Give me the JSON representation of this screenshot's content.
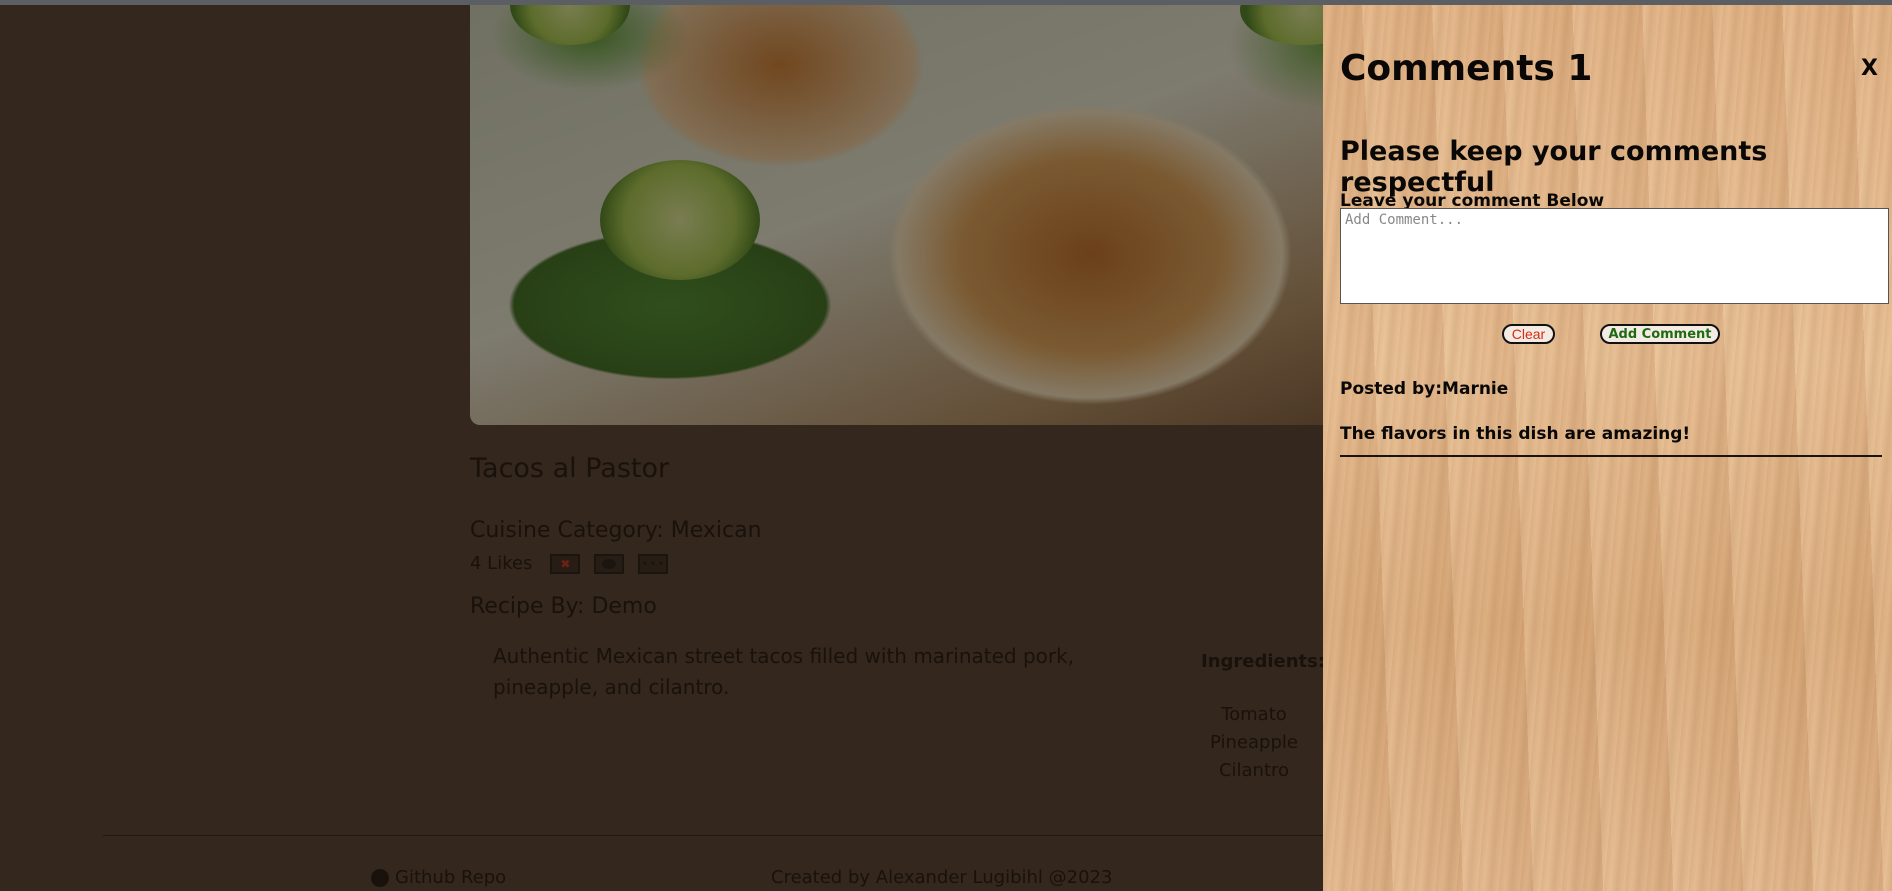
{
  "recipe": {
    "title": "Tacos al Pastor",
    "cuisine_label": "Cuisine Category: Mexican",
    "likes_text": "4 Likes",
    "icons": [
      "thumbs-down-icon",
      "comment-icon",
      "more-options-icon"
    ],
    "byline": "Recipe By: Demo",
    "description": "Authentic Mexican street tacos filled with marinated pork, pineapple, and cilantro.",
    "ingredients_title": "Ingredients:",
    "ingredients": [
      "Tomato",
      "Pineapple",
      "Cilantro"
    ]
  },
  "footer": {
    "github_label": "Github Repo",
    "credit": "Created by Alexander Lugibihl @2023"
  },
  "comments": {
    "title": "Comments 1",
    "close_label": "X",
    "notice": "Please keep your comments respectful",
    "input_label": "Leave your comment Below",
    "placeholder": "Add Comment...",
    "clear_label": "Clear",
    "add_label": "Add Comment",
    "items": [
      {
        "posted_by": "Posted by:Marnie",
        "text": "The flavors in this dish are amazing!"
      }
    ]
  },
  "colors": {
    "page_bg": "#45372c",
    "clear_text": "#d62b12",
    "add_text": "#1f6b12",
    "drawer_wood": "#e2b487"
  }
}
